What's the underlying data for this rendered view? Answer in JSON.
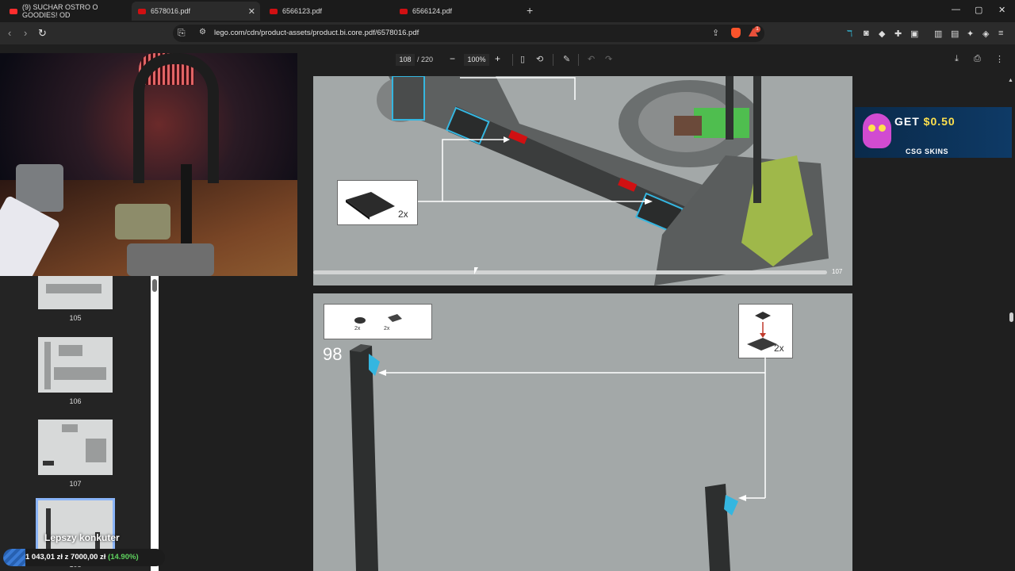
{
  "tabs": [
    {
      "title": "(9) SUCHAR OSTRO O GOODIES! OD",
      "favicon": "youtube-icon"
    },
    {
      "title": "6578016.pdf",
      "favicon": "lego-icon",
      "active": true
    },
    {
      "title": "6566123.pdf",
      "favicon": "lego-icon"
    },
    {
      "title": "6566124.pdf",
      "favicon": "lego-icon"
    }
  ],
  "window_controls": {
    "minimize": "—",
    "maximize": "▢",
    "close": "✕"
  },
  "address_bar": {
    "url": "lego.com/cdn/product-assets/product.bi.core.pdf/6578016.pdf",
    "alert_count": "1"
  },
  "pdf_toolbar": {
    "page_current": "108",
    "page_total": "/ 220",
    "zoom": "100%",
    "zoom_out": "−",
    "zoom_in": "+"
  },
  "thumbnails": [
    {
      "page": "105"
    },
    {
      "page": "106"
    },
    {
      "page": "107"
    },
    {
      "page": "108",
      "selected": true
    }
  ],
  "overlay": {
    "label": "Lepszy konkuter",
    "amount": "1 043,01 zł",
    "connector": "z",
    "goal": "7000,00 zł",
    "percent": "(14.90%)",
    "progress_fraction": 0.149
  },
  "pdf_pages": {
    "top": {
      "callout_qty": "2x",
      "page_number": "107"
    },
    "bottom": {
      "step": "98",
      "parts_qty_1": "2x",
      "parts_qty_2": "2x",
      "callout_qty": "2x"
    }
  },
  "ad": {
    "headline_prefix": "GET ",
    "headline_amount": "$0.50",
    "brand": "CSG SKINS"
  },
  "colors": {
    "accent": "#8ab4f8",
    "lego_red": "#d01012",
    "page_bg": "#a3a8a8",
    "progress_green": "#5fd35f"
  }
}
